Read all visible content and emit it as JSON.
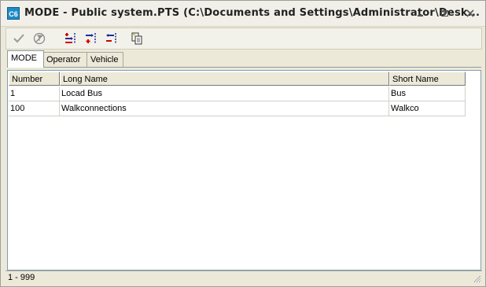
{
  "window": {
    "app_icon_text": "C6",
    "title": "MODE - Public system.PTS (C:\\Documents and Settings\\Administrator\\Desk..."
  },
  "toolbar": {
    "buttons": [
      {
        "icon": "checkmark-icon",
        "label": "Confirm"
      },
      {
        "icon": "no-filter-icon",
        "label": "Filter"
      },
      {
        "icon": "insert-row-icon",
        "label": "Insert"
      },
      {
        "icon": "append-row-icon",
        "label": "Append"
      },
      {
        "icon": "delete-row-icon",
        "label": "Delete"
      },
      {
        "icon": "copy-icon",
        "label": "Copy"
      }
    ]
  },
  "tabs": [
    {
      "label": "MODE",
      "active": true
    },
    {
      "label": "Operator",
      "active": false
    },
    {
      "label": "Vehicle",
      "active": false
    }
  ],
  "table": {
    "columns": [
      "Number",
      "Long Name",
      "Short Name"
    ],
    "rows": [
      [
        "1",
        "Locad Bus",
        "Bus"
      ],
      [
        "100",
        "Walkconnections",
        "Walkco"
      ]
    ]
  },
  "status": {
    "text": "1 - 999"
  }
}
